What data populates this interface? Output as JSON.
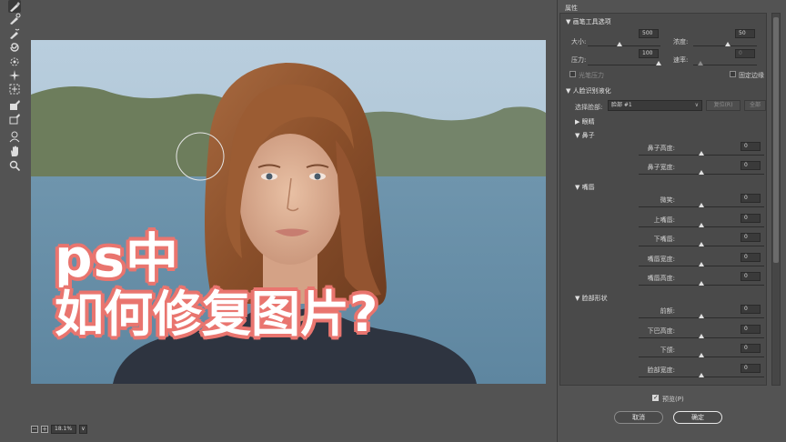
{
  "toolbar": {
    "tools": [
      "forward-warp-tool",
      "reconstruct-tool",
      "smooth-tool",
      "twirl-tool",
      "pucker-tool",
      "bloat-tool",
      "push-left-tool",
      "freeze-mask-tool",
      "thaw-mask-tool",
      "face-tool",
      "hand-tool",
      "zoom-tool"
    ]
  },
  "canvas": {
    "caption_line1": "ps中",
    "caption_line2": "如何修复图片?",
    "zoom_value": "18.1%",
    "zoom_out": "−",
    "zoom_in": "+",
    "zoom_dropdown": "∨"
  },
  "panel": {
    "title": "属性",
    "brush_section": "▼ 画笔工具选项",
    "size_label": "大小:",
    "size_value": "500",
    "density_label": "浓度:",
    "density_value": "50",
    "pressure_label": "压力:",
    "pressure_value": "100",
    "rate_label": "速率:",
    "rate_value": "0",
    "stylus_label": "光笔压力",
    "pin_edges_label": "固定边缘",
    "face_section": "▼ 人脸识别液化",
    "select_face_label": "选择脸部:",
    "select_face_value": "脸部 #1",
    "reset_button": "复位(R)",
    "all_button": "全部",
    "eyes_group": "▶ 眼睛",
    "nose_group": "▼ 鼻子",
    "nose_sliders": [
      {
        "label": "鼻子高度:",
        "value": "0"
      },
      {
        "label": "鼻子宽度:",
        "value": "0"
      }
    ],
    "mouth_group": "▼ 嘴唇",
    "mouth_sliders": [
      {
        "label": "微笑:",
        "value": "0"
      },
      {
        "label": "上嘴唇:",
        "value": "0"
      },
      {
        "label": "下嘴唇:",
        "value": "0"
      },
      {
        "label": "嘴唇宽度:",
        "value": "0"
      },
      {
        "label": "嘴唇高度:",
        "value": "0"
      }
    ],
    "face_shape_group": "▼ 脸部形状",
    "face_shape_sliders": [
      {
        "label": "前额:",
        "value": "0"
      },
      {
        "label": "下巴高度:",
        "value": "0"
      },
      {
        "label": "下颌:",
        "value": "0"
      },
      {
        "label": "脸部宽度:",
        "value": "0"
      }
    ],
    "preview_label": "预览(P)",
    "cancel_button": "取消",
    "ok_button": "确定"
  },
  "colors": {
    "panel_bg": "#535353",
    "caption_outline": "#e9756f",
    "caption_fill": "#ffffff"
  }
}
